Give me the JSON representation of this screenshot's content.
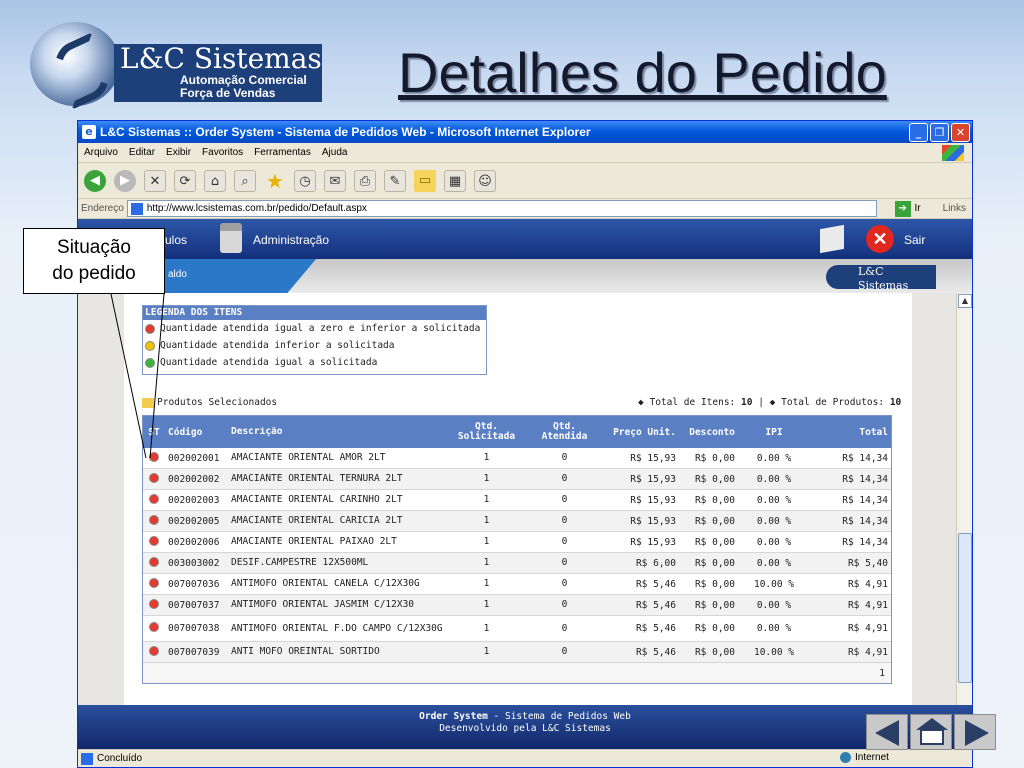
{
  "slide": {
    "title": "Detalhes do Pedido",
    "logo": {
      "name": "L&C Sistemas",
      "tagline_1": "Automação Comercial",
      "tagline_2": "Força de Vendas"
    },
    "callout": {
      "line1": "Situação",
      "line2": "do pedido"
    }
  },
  "browser": {
    "window_title": "L&C Sistemas :: Order System - Sistema de Pedidos Web - Microsoft Internet Explorer",
    "menu": [
      "Arquivo",
      "Editar",
      "Exibir",
      "Favoritos",
      "Ferramentas",
      "Ajuda"
    ],
    "address_label": "Endereço",
    "url": "http://www.lcsistemas.com.br/pedido/Default.aspx",
    "go_label": "Ir",
    "links_label": "Links",
    "status_text": "Concluído",
    "zone_text": "Internet"
  },
  "app": {
    "nav_modules_label": "ulos",
    "nav_admin_label": "Administração",
    "nav_exit_label": "Sair",
    "crumb_label": "aldo",
    "mini_logo": "L&C Sistemas",
    "legend": {
      "title": "LEGENDA DOS ITENS",
      "items": [
        {
          "label": "Quantidade atendida igual a zero e inferior a solicitada",
          "color": "#e53a2e"
        },
        {
          "label": "Quantidade atendida inferior a solicitada",
          "color": "#f2c200"
        },
        {
          "label": "Quantidade atendida igual a solicitada",
          "color": "#3cb43c"
        }
      ]
    },
    "products_heading": "Produtos Selecionados",
    "total_items_label": "Total de Itens:",
    "total_items_value": "10",
    "separator": "|",
    "total_products_label": "Total de Produtos:",
    "total_products_value": "10",
    "table": {
      "columns": {
        "st": "ST",
        "codigo": "Código",
        "descricao": "Descrição",
        "qtd_solicitada": "Qtd. Solicitada",
        "qtd_atendida": "Qtd. Atendida",
        "preco_unit": "Preço Unit.",
        "desconto": "Desconto",
        "ipi": "IPI",
        "total": "Total"
      },
      "rows": [
        {
          "codigo": "002002001",
          "descricao": "AMACIANTE ORIENTAL AMOR 2LT",
          "qs": "1",
          "qa": "0",
          "pu": "R$ 15,93",
          "desc": "R$ 0,00",
          "ipi": "0.00 %",
          "tot": "R$ 14,34"
        },
        {
          "codigo": "002002002",
          "descricao": "AMACIANTE ORIENTAL TERNURA 2LT",
          "qs": "1",
          "qa": "0",
          "pu": "R$ 15,93",
          "desc": "R$ 0,00",
          "ipi": "0.00 %",
          "tot": "R$ 14,34"
        },
        {
          "codigo": "002002003",
          "descricao": "AMACIANTE ORIENTAL CARINHO 2LT",
          "qs": "1",
          "qa": "0",
          "pu": "R$ 15,93",
          "desc": "R$ 0,00",
          "ipi": "0.00 %",
          "tot": "R$ 14,34"
        },
        {
          "codigo": "002002005",
          "descricao": "AMACIANTE ORIENTAL CARICIA 2LT",
          "qs": "1",
          "qa": "0",
          "pu": "R$ 15,93",
          "desc": "R$ 0,00",
          "ipi": "0.00 %",
          "tot": "R$ 14,34"
        },
        {
          "codigo": "002002006",
          "descricao": "AMACIANTE ORIENTAL PAIXAO 2LT",
          "qs": "1",
          "qa": "0",
          "pu": "R$ 15,93",
          "desc": "R$ 0,00",
          "ipi": "0.00 %",
          "tot": "R$ 14,34"
        },
        {
          "codigo": "003003002",
          "descricao": "DESIF.CAMPESTRE 12X500ML",
          "qs": "1",
          "qa": "0",
          "pu": "R$ 6,00",
          "desc": "R$ 0,00",
          "ipi": "0.00 %",
          "tot": "R$ 5,40"
        },
        {
          "codigo": "007007036",
          "descricao": "ANTIMOFO ORIENTAL CANELA C/12X30G",
          "qs": "1",
          "qa": "0",
          "pu": "R$ 5,46",
          "desc": "R$ 0,00",
          "ipi": "10.00 %",
          "tot": "R$ 4,91"
        },
        {
          "codigo": "007007037",
          "descricao": "ANTIMOFO ORIENTAL JASMIM C/12X30",
          "qs": "1",
          "qa": "0",
          "pu": "R$ 5,46",
          "desc": "R$ 0,00",
          "ipi": "0.00 %",
          "tot": "R$ 4,91"
        },
        {
          "codigo": "007007038",
          "descricao": "ANTIMOFO ORIENTAL F.DO CAMPO C/12X30G",
          "qs": "1",
          "qa": "0",
          "pu": "R$ 5,46",
          "desc": "R$ 0,00",
          "ipi": "0.00 %",
          "tot": "R$ 4,91"
        },
        {
          "codigo": "007007039",
          "descricao": "ANTI MOFO OREINTAL SORTIDO",
          "qs": "1",
          "qa": "0",
          "pu": "R$ 5,46",
          "desc": "R$ 0,00",
          "ipi": "10.00 %",
          "tot": "R$ 4,91"
        }
      ],
      "status_color": "#e53a2e",
      "page_number": "1"
    },
    "footer": {
      "line1_bold": "Order System",
      "line1_rest": " - Sistema de Pedidos Web",
      "line2": "Desenvolvido pela L&C Sistemas"
    }
  }
}
